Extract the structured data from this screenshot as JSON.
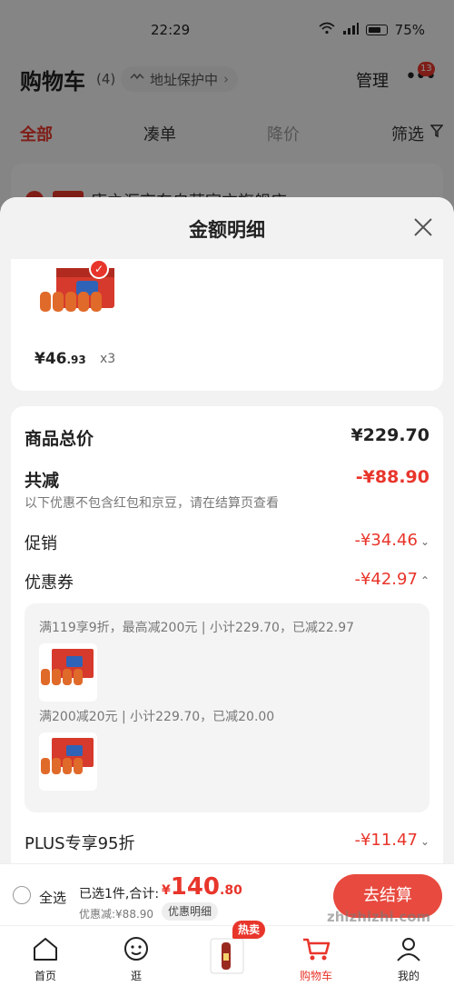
{
  "status_bar": {
    "time": "22:29",
    "battery": "75%"
  },
  "header": {
    "title": "购物车",
    "count": "(4)",
    "address_label": "地址保护中",
    "manage_label": "管理",
    "badge": "13"
  },
  "tabs": [
    {
      "label": "全部"
    },
    {
      "label": "凑单"
    },
    {
      "label": "降价"
    },
    {
      "label": "筛选"
    }
  ],
  "store_name": "康之汇京东自营官方旗舰店",
  "sheet": {
    "title": "金额明细",
    "item": {
      "price_main": "¥46",
      "price_dec": ".93",
      "qty": "x3"
    },
    "total_label": "商品总价",
    "total_value": "¥229.70",
    "reduce_label": "共减",
    "reduce_value": "-¥88.90",
    "note": "以下优惠不包含红包和京豆，请在结算页查看",
    "promo_label": "促销",
    "promo_value": "-¥34.46",
    "coupon_label": "优惠券",
    "coupon_value": "-¥42.97",
    "coupons": [
      {
        "text": "满119享9折，最高减200元 | 小计229.70，已减22.97"
      },
      {
        "text": "满200减20元 | 小计229.70，已减20.00"
      }
    ],
    "plus_label": "PLUS专享95折",
    "plus_value": "-¥11.47"
  },
  "bottom_bar": {
    "select_all": "全选",
    "selected_total": "已选1件,合计:",
    "currency": "¥",
    "amount_int": "140",
    "amount_dec": ".80",
    "discount_line": "优惠减:¥88.90",
    "detail_label": "优惠明细",
    "checkout_label": "去结算"
  },
  "tabbar": [
    {
      "label": "首页"
    },
    {
      "label": "逛"
    },
    {
      "label": "热卖"
    },
    {
      "label": "购物车"
    },
    {
      "label": "我的"
    }
  ],
  "colors": {
    "accent": "#e8352b",
    "checkout": "#e84a3f"
  },
  "watermark": "zhizhizhi.com"
}
